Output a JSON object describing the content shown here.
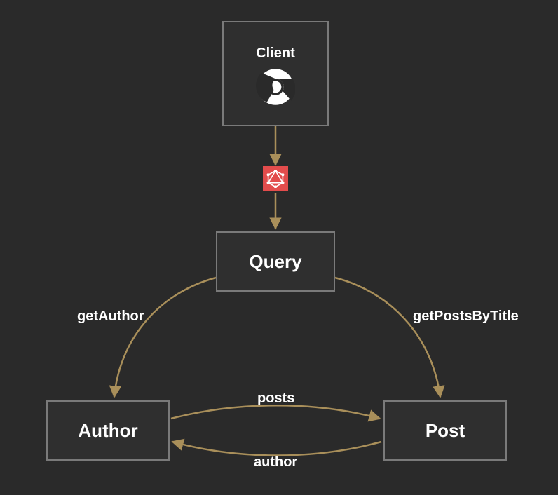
{
  "nodes": {
    "client": {
      "label": "Client",
      "icon": "chrome-icon"
    },
    "query": {
      "label": "Query"
    },
    "author": {
      "label": "Author"
    },
    "post": {
      "label": "Post"
    }
  },
  "edges": {
    "client_to_query": {
      "via_icon": "graphql-icon"
    },
    "query_to_author": {
      "label": "getAuthor"
    },
    "query_to_post": {
      "label": "getPostsByTitle"
    },
    "author_to_post": {
      "label": "posts"
    },
    "post_to_author": {
      "label": "author"
    }
  },
  "colors": {
    "line": "#a98f5a",
    "badge": "#e34c4c",
    "bg": "#2a2a2a",
    "border": "#7a7a7a"
  }
}
